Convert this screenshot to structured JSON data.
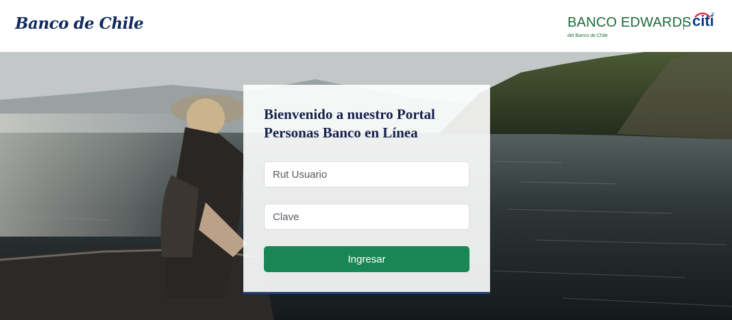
{
  "header": {
    "brand_left": "Banco de Chile",
    "brand_right": "BANCO EDWARDS",
    "brand_right_sub": "del Banco de Chile",
    "brand_citi": "citi"
  },
  "login": {
    "title_line1": "Bienvenido a nuestro Portal",
    "title_line2_prefix": "Personas ",
    "title_line2_bold": "Banco en Línea",
    "rut_placeholder": "Rut Usuario",
    "clave_placeholder": "Clave",
    "submit_label": "Ingresar"
  },
  "colors": {
    "brand_navy": "#102a5c",
    "edwards_green": "#1c6b3a",
    "citi_blue": "#0a3c8c",
    "button_green": "#198754",
    "card_border": "#1f3f78"
  }
}
